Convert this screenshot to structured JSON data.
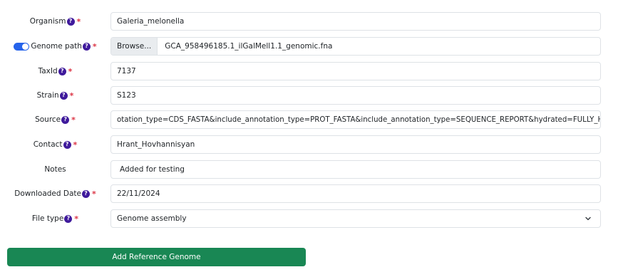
{
  "form": {
    "fields": [
      {
        "label": "Organism",
        "value": "Galeria_melonella",
        "required": true,
        "help": "?"
      },
      {
        "label": "Genome path",
        "browse_label": "Browse...",
        "value": "GCA_958496185.1_ilGalMell1.1_genomic.fna",
        "required": true,
        "help": "?",
        "toggle_on": true
      },
      {
        "label": "TaxId",
        "value": "7137",
        "required": true,
        "help": "?"
      },
      {
        "label": "Strain",
        "value": "S123",
        "required": true,
        "help": "?"
      },
      {
        "label": "Source",
        "value": "otation_type=CDS_FASTA&include_annotation_type=PROT_FASTA&include_annotation_type=SEQUENCE_REPORT&hydrated=FULLY_HYDRATED",
        "required": true,
        "help": "?"
      },
      {
        "label": "Contact",
        "value": "Hrant_Hovhannisyan",
        "required": true,
        "help": "?"
      },
      {
        "label": "Notes",
        "value": "Added for testing",
        "required": false
      },
      {
        "label": "Downloaded Date",
        "value": "22/11/2024",
        "required": true,
        "help": "?"
      },
      {
        "label": "File type",
        "value": "Genome assembly",
        "required": true,
        "help": "?"
      }
    ],
    "required_mark": "*",
    "submit_label": "Add Reference Genome"
  },
  "colors": {
    "accent": "#2563eb",
    "help_badge": "#3f1a9c",
    "required": "#dc3545",
    "submit": "#198754"
  }
}
